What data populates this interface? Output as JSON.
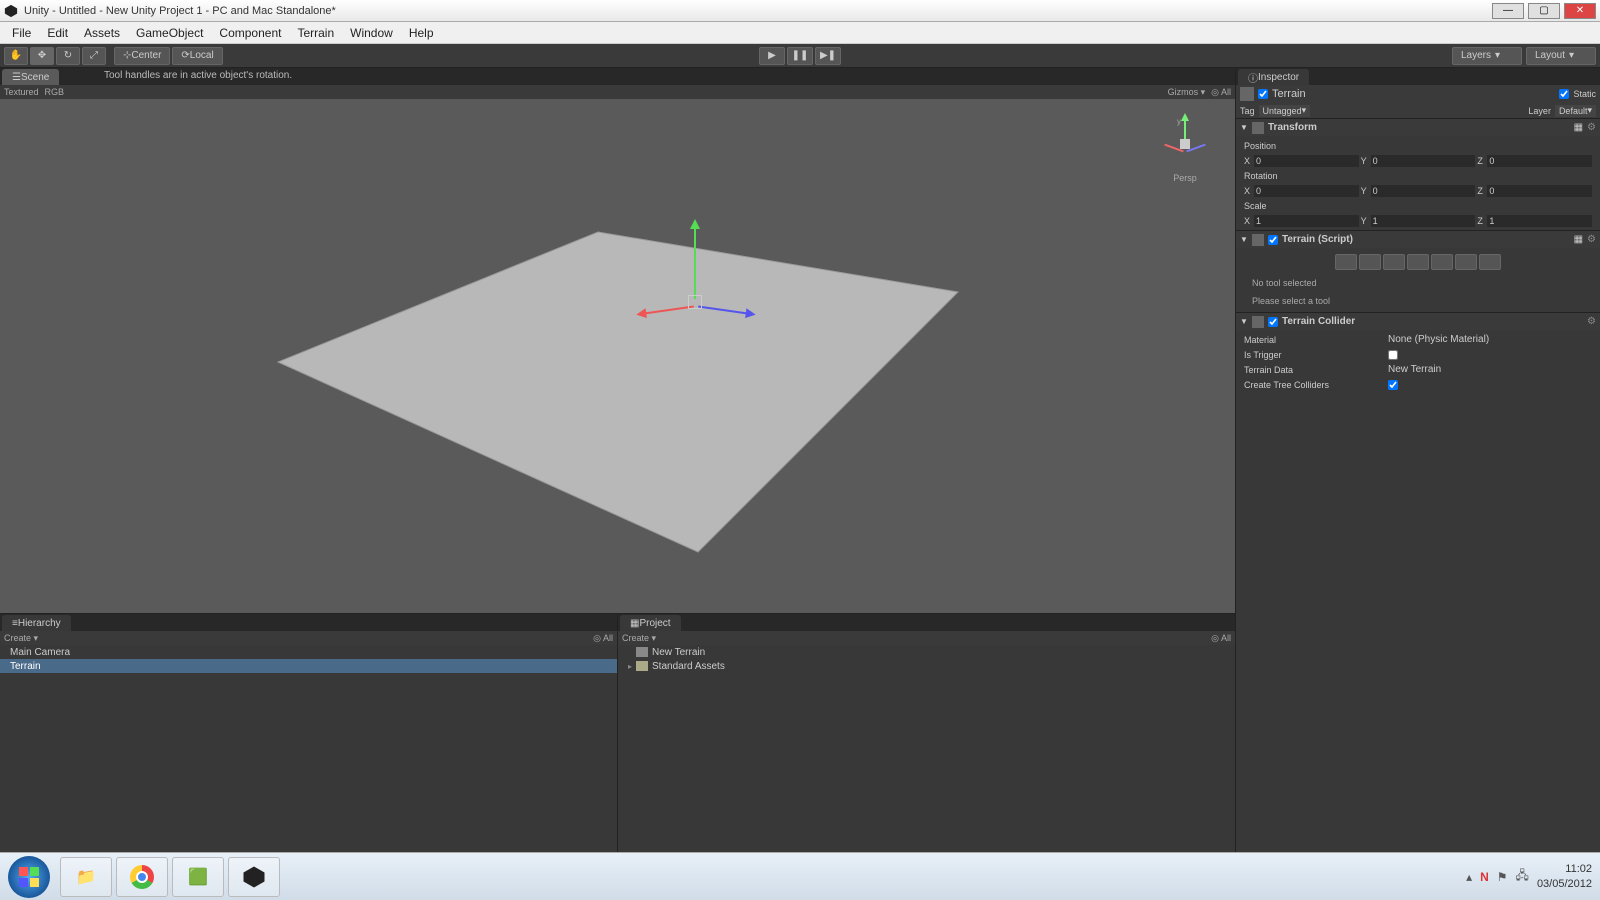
{
  "window": {
    "title": "Unity - Untitled - New Unity Project 1 - PC and Mac Standalone*"
  },
  "menubar": {
    "items": [
      "File",
      "Edit",
      "Assets",
      "GameObject",
      "Component",
      "Terrain",
      "Window",
      "Help"
    ]
  },
  "toolbar": {
    "pivot_center": "Center",
    "pivot_local": "Local",
    "layers": "Layers",
    "layout": "Layout",
    "tooltip": "Tool handles are in active object's rotation."
  },
  "scene": {
    "tab": "Scene",
    "shading": "Textured",
    "render_mode": "RGB",
    "gizmos": "Gizmos",
    "all": "All",
    "persp": "Persp"
  },
  "hierarchy": {
    "tab": "Hierarchy",
    "create": "Create",
    "search_hint": "All",
    "items": [
      {
        "name": "Main Camera",
        "selected": false
      },
      {
        "name": "Terrain",
        "selected": true
      }
    ]
  },
  "project": {
    "tab": "Project",
    "create": "Create",
    "search_hint": "All",
    "items": [
      {
        "name": "New Terrain",
        "type": "terrain"
      },
      {
        "name": "Standard Assets",
        "type": "folder"
      }
    ]
  },
  "inspector": {
    "tab": "Inspector",
    "gameobject": {
      "enabled": true,
      "name": "Terrain",
      "static": true,
      "static_label": "Static",
      "tag_label": "Tag",
      "tag": "Untagged",
      "layer_label": "Layer",
      "layer": "Default"
    },
    "transform": {
      "title": "Transform",
      "position_label": "Position",
      "rotation_label": "Rotation",
      "scale_label": "Scale",
      "position": {
        "x": "0",
        "y": "0",
        "z": "0"
      },
      "rotation": {
        "x": "0",
        "y": "0",
        "z": "0"
      },
      "scale": {
        "x": "1",
        "y": "1",
        "z": "1"
      }
    },
    "terrain_script": {
      "title": "Terrain (Script)",
      "no_tool": "No tool selected",
      "please_select": "Please select a tool"
    },
    "terrain_collider": {
      "title": "Terrain Collider",
      "material_label": "Material",
      "material_value": "None (Physic Material)",
      "is_trigger_label": "Is Trigger",
      "terrain_data_label": "Terrain Data",
      "terrain_data_value": "New Terrain",
      "create_tree_label": "Create Tree Colliders"
    }
  },
  "taskbar": {
    "time": "11:02",
    "date": "03/05/2012"
  }
}
